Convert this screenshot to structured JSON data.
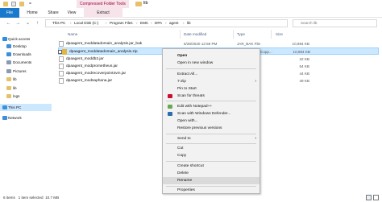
{
  "window": {
    "title": "lib",
    "context_tab_header": "Compressed Folder Tools",
    "qa_separator": "="
  },
  "ribbon": {
    "tabs": [
      "File",
      "Home",
      "Share",
      "View",
      "Extract"
    ]
  },
  "nav": {
    "back": "←",
    "forward": "→",
    "recent": "⌄",
    "up": "↑",
    "breadcrumb": [
      "This PC",
      "Local Disk (C:)",
      "Program Files",
      "EMC",
      "DPA",
      "agent",
      "lib"
    ],
    "search_placeholder": "Search lib"
  },
  "sidebar": {
    "items": [
      {
        "label": "Quick access",
        "color": "#2b8ee4"
      },
      {
        "label": "Desktop",
        "color": "#3c8fd9"
      },
      {
        "label": "Downloads",
        "color": "#3c8fd9"
      },
      {
        "label": "Documents",
        "color": "#8a9bb0"
      },
      {
        "label": "Pictures",
        "color": "#8a9bb0"
      },
      {
        "label": "lib",
        "color": "#e7c16a"
      },
      {
        "label": "lib",
        "color": "#e7c16a"
      },
      {
        "label": "logs",
        "color": "#e7c16a"
      },
      {
        "label": "This PC",
        "color": "#3c8fd9"
      },
      {
        "label": "Network",
        "color": "#3c8fd9"
      }
    ]
  },
  "columns": {
    "name": "Name",
    "date": "Date modified",
    "type": "Type",
    "size": "Size"
  },
  "files": [
    {
      "name": "dpaagent_moddatadomain_analysis.jar_bak",
      "date": "5/28/2020 12:59 PM",
      "type": "JAR_BAK File",
      "size": "10,984 KB"
    },
    {
      "name": "dpaagent_moddatadomain_analysis.zip",
      "date": "",
      "type": "Copp...",
      "size": "10,984 KB"
    },
    {
      "name": "dpaagent_moddb2.jar",
      "date": "",
      "type": "",
      "size": "22 KB"
    },
    {
      "name": "dpaagent_modprometheus.jar",
      "date": "",
      "type": "",
      "size": "54 KB"
    },
    {
      "name": "dpaagent_modrecoverpoint4vm.jar",
      "date": "",
      "type": "",
      "size": "44 KB"
    },
    {
      "name": "dpaagent_modsaphana.jar",
      "date": "",
      "type": "",
      "size": "49 KB"
    }
  ],
  "context_menu": {
    "items": [
      {
        "label": "Open",
        "bold": true
      },
      {
        "label": "Open in new window"
      },
      {
        "label": "Extract All..."
      },
      {
        "label": "7-Zip",
        "submenu": true
      },
      {
        "label": "Pin to Start"
      },
      {
        "label": "Scan for threats",
        "icon": "scan-icon",
        "icon_color": "#c8102e"
      },
      {
        "label": "Edit with Notepad++",
        "icon": "notepad-icon",
        "icon_color": "#6aa84f"
      },
      {
        "label": "Scan with Windows Defender...",
        "icon": "defender-icon",
        "icon_color": "#2b6cb0"
      },
      {
        "label": "Open with..."
      },
      {
        "label": "Restore previous versions"
      },
      {
        "label": "Send to",
        "submenu": true
      },
      {
        "label": "Cut"
      },
      {
        "label": "Copy"
      },
      {
        "label": "Create shortcut"
      },
      {
        "label": "Delete"
      },
      {
        "label": "Rename"
      },
      {
        "label": "Properties"
      }
    ],
    "submenu_arrow": "›"
  },
  "status": {
    "text": "6 items   1 item selected  10.7 MB"
  },
  "colors": {
    "file_tab": "#1979ca",
    "context_tab": "#f7e3ea",
    "selection": "#cce8ff",
    "zip_icon": "#e2b443"
  }
}
